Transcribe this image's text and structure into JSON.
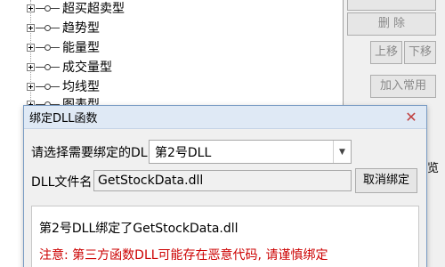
{
  "tree": {
    "items": [
      {
        "label": "超买超卖型"
      },
      {
        "label": "趋势型"
      },
      {
        "label": "能量型"
      },
      {
        "label": "成交量型"
      },
      {
        "label": "均线型"
      },
      {
        "label": "图表型"
      }
    ]
  },
  "side_buttons": {
    "delete": "删 除",
    "move_up": "上移",
    "move_down": "下移",
    "add_common": "加入常用"
  },
  "edge_text": "览",
  "dialog": {
    "title": "绑定DLL函数",
    "close_icon": "close-icon",
    "select_label": "请选择需要绑定的DLL",
    "select_value": "第2号DLL",
    "file_label": "DLL文件名",
    "file_value": "GetStockData.dll",
    "unbind_label": "取消绑定",
    "info_bound": "第2号DLL绑定了GetStockData.dll",
    "info_warning": "注意: 第三方函数DLL可能存在恶意代码, 请谨慎绑定",
    "warning_color": "#cc0000"
  }
}
